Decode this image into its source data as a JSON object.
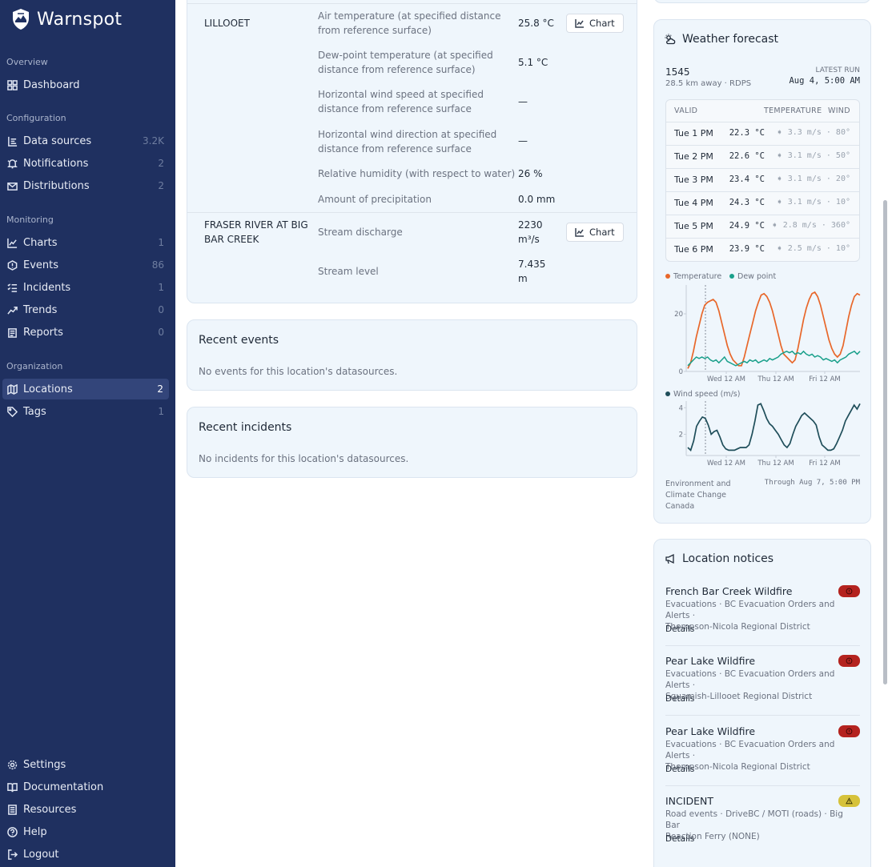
{
  "app": {
    "name": "Warnspot"
  },
  "nav": {
    "overview_heading": "Overview",
    "dashboard": "Dashboard",
    "configuration_heading": "Configuration",
    "data_sources": "Data sources",
    "data_sources_count": "3.2K",
    "notifications": "Notifications",
    "notifications_count": "2",
    "distributions": "Distributions",
    "distributions_count": "2",
    "monitoring_heading": "Monitoring",
    "charts": "Charts",
    "charts_count": "1",
    "events": "Events",
    "events_count": "86",
    "incidents": "Incidents",
    "incidents_count": "1",
    "trends": "Trends",
    "trends_count": "0",
    "reports": "Reports",
    "reports_count": "0",
    "organization_heading": "Organization",
    "locations": "Locations",
    "locations_count": "2",
    "tags": "Tags",
    "tags_count": "1",
    "settings": "Settings",
    "documentation": "Documentation",
    "resources": "Resources",
    "help": "Help",
    "logout": "Logout"
  },
  "readings": {
    "chart_label": "Chart",
    "lillooet": {
      "name": "LILLOOET",
      "rows": [
        {
          "label1": "Air temperature (at specified distance",
          "label2": "from reference surface)",
          "value": "25.8 °C"
        },
        {
          "label1": "Dew-point temperature (at specified",
          "label2": "distance from reference surface)",
          "value": "5.1 °C"
        },
        {
          "label1": "Horizontal wind speed at specified",
          "label2": "distance from reference surface",
          "value": "—"
        },
        {
          "label1": "Horizontal wind direction at specified",
          "label2": "distance from reference surface",
          "value": "—"
        },
        {
          "label1": "Relative humidity (with respect to water)",
          "value": "26 %"
        },
        {
          "label1": "Amount of precipitation",
          "value": "0.0 mm"
        }
      ]
    },
    "fraser": {
      "name1": "FRASER RIVER AT BIG",
      "name2": "BAR CREEK",
      "rows": [
        {
          "label1": "Stream discharge",
          "value1": "2230",
          "value2": "m³/s"
        },
        {
          "label1": "Stream level",
          "value1": "7.435",
          "value2": "m"
        }
      ]
    }
  },
  "recent_events": {
    "title": "Recent events",
    "empty": "No events for this location's datasources."
  },
  "recent_incidents": {
    "title": "Recent incidents",
    "empty": "No incidents for this location's datasources."
  },
  "forecast": {
    "title": "Weather forecast",
    "station": "1545",
    "station_sub": "28.5 km away · RDPS",
    "latest_run_label": "LATEST RUN",
    "latest_run": "Aug 4, 5:00 AM",
    "headers": {
      "valid": "VALID",
      "temperature": "TEMPERATURE",
      "wind": "WIND"
    },
    "rows": [
      {
        "time": "Tue 1 PM",
        "temp": "22.3 °C",
        "wind": "3.3 m/s · 80°"
      },
      {
        "time": "Tue 2 PM",
        "temp": "22.6 °C",
        "wind": "3.1 m/s · 50°"
      },
      {
        "time": "Tue 3 PM",
        "temp": "23.4 °C",
        "wind": "3.1 m/s · 20°"
      },
      {
        "time": "Tue 4 PM",
        "temp": "24.3 °C",
        "wind": "3.1 m/s · 10°"
      },
      {
        "time": "Tue 5 PM",
        "temp": "24.9 °C",
        "wind": "2.8 m/s · 360°"
      },
      {
        "time": "Tue 6 PM",
        "temp": "23.9 °C",
        "wind": "2.5 m/s · 10°"
      }
    ],
    "source1": "Environment and",
    "source2": "Climate Change",
    "source3": "Canada",
    "through": "Through Aug 7, 5:00 PM"
  },
  "chart_data": [
    {
      "type": "line",
      "legend": [
        "Temperature",
        "Dew point"
      ],
      "colors": {
        "Temperature": "#e8672a",
        "Dew point": "#1aa08b"
      },
      "yticks": [
        0,
        20
      ],
      "ylim": [
        0,
        30
      ],
      "xticks": [
        "Wed 12 AM",
        "Thu 12 AM",
        "Fri 12 AM"
      ],
      "series": [
        {
          "name": "Temperature",
          "values": [
            1,
            3,
            7,
            12,
            16,
            20,
            23,
            24,
            24.5,
            25,
            24,
            21,
            17,
            13,
            9,
            6,
            4,
            3,
            2,
            2,
            5,
            9,
            13,
            17,
            21,
            24,
            26.5,
            27,
            26,
            24,
            21,
            17,
            13,
            9,
            6,
            5,
            4,
            3,
            4,
            8,
            13,
            18,
            22,
            25,
            27,
            27.5,
            26,
            23,
            19,
            15,
            11,
            8,
            6,
            5,
            6,
            9,
            14,
            19,
            23,
            26,
            27,
            26.5
          ]
        },
        {
          "name": "Dew point",
          "values": [
            2,
            3,
            4,
            5,
            4.5,
            5,
            4.5,
            5,
            4,
            3.5,
            4,
            3,
            4,
            5,
            3.5,
            3,
            2.5,
            2,
            2.5,
            3,
            3.5,
            3,
            4,
            3.5,
            4,
            3,
            3.5,
            4,
            3.5,
            4.5,
            4,
            4.5,
            5,
            6,
            6.5,
            7,
            6.5,
            7,
            6,
            6.5,
            6,
            7,
            6,
            5.5,
            6,
            5,
            5.5,
            5,
            4,
            4.5,
            4,
            3.5,
            4,
            3,
            4,
            4.5,
            5,
            6,
            6.5,
            7,
            6,
            7
          ]
        }
      ]
    },
    {
      "type": "line",
      "legend": [
        "Wind speed (m/s)"
      ],
      "colors": {
        "Wind speed (m/s)": "#1f4e5a"
      },
      "yticks": [
        2,
        4
      ],
      "ylim": [
        0.4,
        4.5
      ],
      "xticks": [
        "Wed 12 AM",
        "Thu 12 AM",
        "Fri 12 AM"
      ],
      "series": [
        {
          "name": "Wind speed (m/s)",
          "values": [
            1.0,
            0.8,
            1.5,
            2.6,
            3.0,
            3.3,
            3.2,
            2.7,
            2.0,
            2.2,
            2.3,
            1.8,
            1.2,
            0.9,
            0.8,
            0.8,
            0.8,
            0.9,
            1.0,
            1.0,
            1.0,
            1.2,
            2.0,
            3.0,
            4.2,
            4.3,
            3.8,
            3.2,
            2.8,
            2.6,
            2.3,
            2.0,
            1.6,
            1.2,
            1.0,
            1.3,
            2.0,
            2.6,
            3.0,
            3.4,
            3.6,
            3.4,
            3.2,
            3.0,
            2.7,
            1.8,
            1.2,
            1.0,
            0.8,
            0.8,
            0.9,
            1.3,
            1.8,
            2.3,
            3.0,
            3.4,
            3.8,
            4.2,
            3.9,
            4.3
          ]
        }
      ]
    }
  ],
  "notices": {
    "title": "Location notices",
    "details_label": "Details",
    "items": [
      {
        "title": "French Bar Creek Wildfire",
        "sub1": "Evacuations · BC Evacuation Orders and Alerts ·",
        "sub2": "Thompson-Nicola Regional District",
        "level": "red"
      },
      {
        "title": "Pear Lake Wildfire",
        "sub1": "Evacuations · BC Evacuation Orders and Alerts ·",
        "sub2": "Squamish-Lillooet Regional District",
        "level": "red"
      },
      {
        "title": "Pear Lake Wildfire",
        "sub1": "Evacuations · BC Evacuation Orders and Alerts ·",
        "sub2": "Thompson-Nicola Regional District",
        "level": "red"
      },
      {
        "title": "INCIDENT",
        "sub1": "Road events · DriveBC / MOTI (roads) · Big Bar",
        "sub2": "Reaction Ferry (NONE)",
        "level": "yellow"
      }
    ]
  }
}
